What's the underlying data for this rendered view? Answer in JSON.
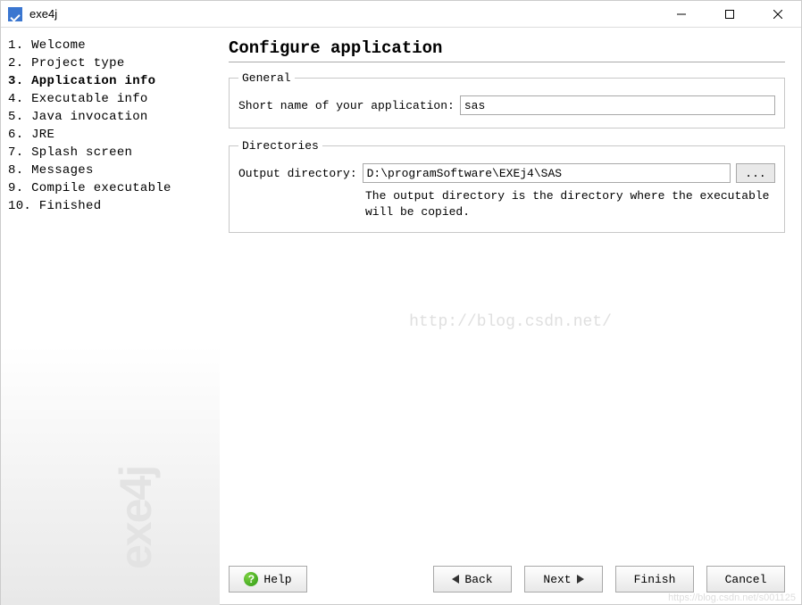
{
  "window": {
    "title": "exe4j",
    "brand": "exe4j"
  },
  "sidebar": {
    "steps": [
      {
        "num": "1.",
        "label": "Welcome"
      },
      {
        "num": "2.",
        "label": "Project type"
      },
      {
        "num": "3.",
        "label": "Application info",
        "current": true
      },
      {
        "num": "4.",
        "label": "Executable info"
      },
      {
        "num": "5.",
        "label": "Java invocation"
      },
      {
        "num": "6.",
        "label": "JRE"
      },
      {
        "num": "7.",
        "label": "Splash screen"
      },
      {
        "num": "8.",
        "label": "Messages"
      },
      {
        "num": "9.",
        "label": "Compile executable"
      },
      {
        "num": "10.",
        "label": "Finished"
      }
    ]
  },
  "page": {
    "title": "Configure application",
    "general": {
      "legend": "General",
      "short_name_label": "Short name of your application:",
      "short_name_value": "sas"
    },
    "directories": {
      "legend": "Directories",
      "output_label": "Output directory:",
      "output_value": "D:\\programSoftware\\EXEj4\\SAS",
      "browse_label": "...",
      "help_text": "The output directory is the directory where the executable will be copied."
    },
    "watermark": "http://blog.csdn.net/"
  },
  "buttons": {
    "help": "Help",
    "back": "Back",
    "next": "Next",
    "finish": "Finish",
    "cancel": "Cancel"
  }
}
